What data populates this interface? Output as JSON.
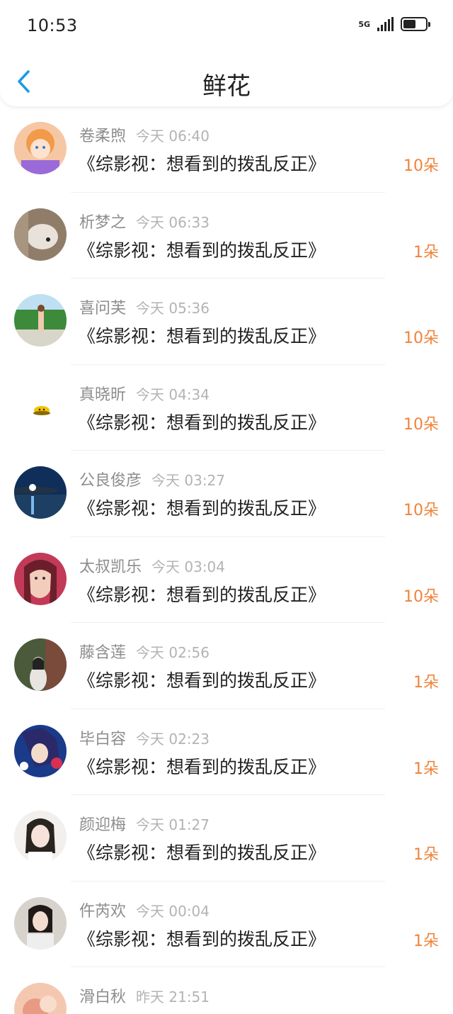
{
  "status": {
    "time": "10:53",
    "network": "5G"
  },
  "header": {
    "title": "鲜花"
  },
  "items": [
    {
      "name": "卷柔煦",
      "time": "今天 06:40",
      "message": "《综影视：想看到的拨乱反正》",
      "count": "10朵"
    },
    {
      "name": "析梦之",
      "time": "今天 06:33",
      "message": "《综影视：想看到的拨乱反正》",
      "count": "1朵"
    },
    {
      "name": "喜问芙",
      "time": "今天 05:36",
      "message": "《综影视：想看到的拨乱反正》",
      "count": "10朵"
    },
    {
      "name": "真晓昕",
      "time": "今天 04:34",
      "message": "《综影视：想看到的拨乱反正》",
      "count": "10朵"
    },
    {
      "name": "公良俊彦",
      "time": "今天 03:27",
      "message": "《综影视：想看到的拨乱反正》",
      "count": "10朵"
    },
    {
      "name": "太叔凯乐",
      "time": "今天 03:04",
      "message": "《综影视：想看到的拨乱反正》",
      "count": "10朵"
    },
    {
      "name": "藤含莲",
      "time": "今天 02:56",
      "message": "《综影视：想看到的拨乱反正》",
      "count": "1朵"
    },
    {
      "name": "毕白容",
      "time": "今天 02:23",
      "message": "《综影视：想看到的拨乱反正》",
      "count": "1朵"
    },
    {
      "name": "颜迎梅",
      "time": "今天 01:27",
      "message": "《综影视：想看到的拨乱反正》",
      "count": "1朵"
    },
    {
      "name": "仵芮欢",
      "time": "今天 00:04",
      "message": "《综影视：想看到的拨乱反正》",
      "count": "1朵"
    },
    {
      "name": "滑白秋",
      "time": "昨天 21:51",
      "message": "",
      "count": ""
    }
  ],
  "colors": {
    "accent": "#f0833a",
    "back": "#1a9be8"
  }
}
